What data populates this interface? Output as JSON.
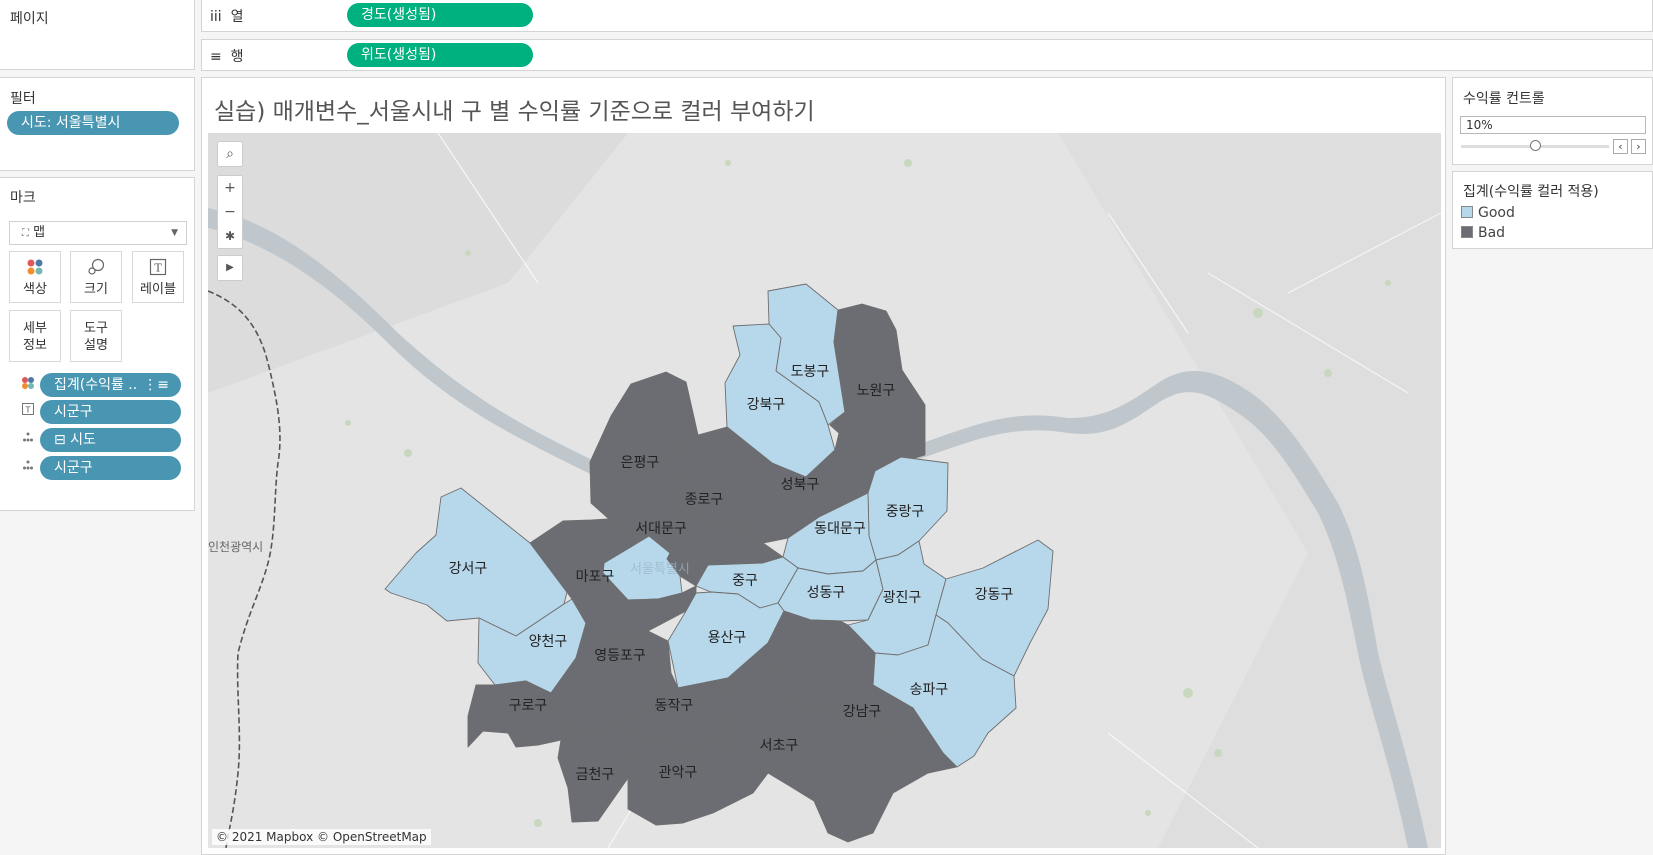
{
  "pages": {
    "title": "페이지"
  },
  "shelves": {
    "columns": {
      "icon": "iii",
      "label": "열",
      "pill": "경도(생성됨)"
    },
    "rows": {
      "icon": "≡",
      "label": "행",
      "pill": "위도(생성됨)"
    }
  },
  "filters": {
    "title": "필터",
    "items": [
      "시도: 서울특별시"
    ]
  },
  "marks": {
    "title": "마크",
    "type": "맵",
    "type_icon": "map-icon",
    "buttons": [
      {
        "label": "색상",
        "icon": "color-dots-icon"
      },
      {
        "label": "크기",
        "icon": "size-circles-icon"
      },
      {
        "label": "레이블",
        "icon": "text-label-icon"
      },
      {
        "label": "세부\n정보",
        "icon": ""
      },
      {
        "label": "도구\n설명",
        "icon": ""
      }
    ],
    "fields": [
      {
        "label": "집계(수익률 ..",
        "icon": "color-dots-icon",
        "suffix": "⋮≡"
      },
      {
        "label": "시군구",
        "icon": "text-label-icon"
      },
      {
        "label": "⊟ 시도",
        "icon": "detail-dots-icon"
      },
      {
        "label": "시군구",
        "icon": "detail-dots-icon"
      }
    ]
  },
  "sheet": {
    "title": "실습) 매개변수_서울시내 구 별 수익률 기준으로 컬러 부여하기",
    "map": {
      "attribution": "© 2021 Mapbox © OpenStreetMap",
      "background_labels": [
        "인천광역시",
        "서울특별시"
      ],
      "tools": [
        "search-icon",
        "zoom-in-icon",
        "zoom-out-icon",
        "pin-icon",
        "play-icon"
      ]
    }
  },
  "districts": [
    {
      "name": "도봉구",
      "category": "Good"
    },
    {
      "name": "노원구",
      "category": "Bad"
    },
    {
      "name": "강북구",
      "category": "Good"
    },
    {
      "name": "은평구",
      "category": "Bad"
    },
    {
      "name": "성북구",
      "category": "Bad"
    },
    {
      "name": "종로구",
      "category": "Bad"
    },
    {
      "name": "중랑구",
      "category": "Good"
    },
    {
      "name": "서대문구",
      "category": "Good"
    },
    {
      "name": "동대문구",
      "category": "Good"
    },
    {
      "name": "강서구",
      "category": "Good"
    },
    {
      "name": "마포구",
      "category": "Bad"
    },
    {
      "name": "중구",
      "category": "Good"
    },
    {
      "name": "성동구",
      "category": "Good"
    },
    {
      "name": "광진구",
      "category": "Good"
    },
    {
      "name": "강동구",
      "category": "Good"
    },
    {
      "name": "양천구",
      "category": "Good"
    },
    {
      "name": "영등포구",
      "category": "Bad"
    },
    {
      "name": "용산구",
      "category": "Good"
    },
    {
      "name": "송파구",
      "category": "Good"
    },
    {
      "name": "구로구",
      "category": "Bad"
    },
    {
      "name": "동작구",
      "category": "Bad"
    },
    {
      "name": "강남구",
      "category": "Bad"
    },
    {
      "name": "서초구",
      "category": "Bad"
    },
    {
      "name": "금천구",
      "category": "Bad"
    },
    {
      "name": "관악구",
      "category": "Bad"
    }
  ],
  "parameter": {
    "title": "수익률 컨트롤",
    "value": "10%",
    "slider_fraction": 0.5
  },
  "legend": {
    "title": "집계(수익률 컬러 적용)",
    "items": [
      {
        "label": "Good",
        "color": "#b7d7ea"
      },
      {
        "label": "Bad",
        "color": "#6b6d73"
      }
    ]
  },
  "colors": {
    "good": "#b7d7ea",
    "bad": "#6b6d73",
    "pill_blue": "#4996b2",
    "pill_green": "#00b180"
  }
}
